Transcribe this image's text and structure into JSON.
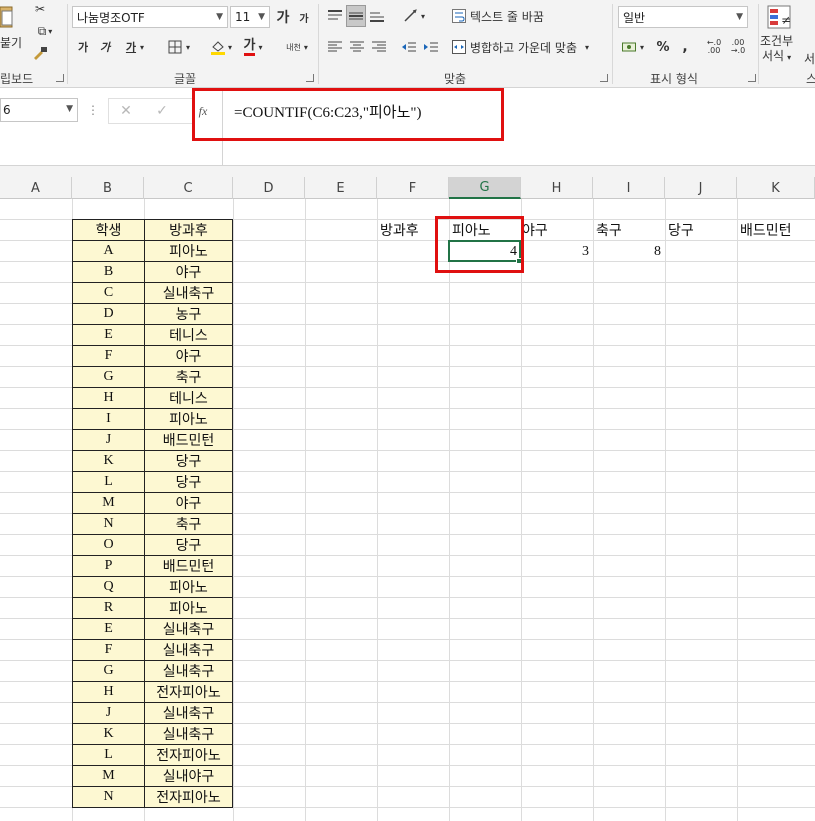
{
  "ribbon": {
    "clipboard": {
      "paste_label": "붙기",
      "group_label": "립보드"
    },
    "font": {
      "font_name": "나눔명조OTF",
      "font_size": "11",
      "grow_label": "가",
      "shrink_label": "가",
      "bold_label": "가",
      "italic_label": "가",
      "underline_label": "가",
      "font_color_label": "가",
      "phonetic_label": "내천",
      "group_label": "글꼴"
    },
    "alignment": {
      "wrap_text_label": "텍스트 줄 바꿈",
      "merge_center_label": "병합하고 가운데 맞춤",
      "group_label": "맞춤"
    },
    "number": {
      "format_value": "일반",
      "percent_label": "%",
      "comma_label": ",",
      "group_label": "표시 형식"
    },
    "styles": {
      "conditional_label_1": "조건부",
      "conditional_label_2": "서식",
      "next_label": "서",
      "group_label_partial": "스"
    }
  },
  "formula_bar": {
    "name_box": "6",
    "cancel_symbol": "✕",
    "enter_symbol": "✓",
    "fx_label": "fx",
    "formula": "=COUNTIF(C6:C23,\"피아노\")"
  },
  "columns": [
    "A",
    "B",
    "C",
    "D",
    "E",
    "F",
    "G",
    "H",
    "I",
    "J",
    "K"
  ],
  "table": {
    "header_student": "학생",
    "header_activity": "방과후",
    "rows": [
      [
        "A",
        "피아노"
      ],
      [
        "B",
        "야구"
      ],
      [
        "C",
        "실내축구"
      ],
      [
        "D",
        "농구"
      ],
      [
        "E",
        "테니스"
      ],
      [
        "F",
        "야구"
      ],
      [
        "G",
        "축구"
      ],
      [
        "H",
        "테니스"
      ],
      [
        "I",
        "피아노"
      ],
      [
        "J",
        "배드민턴"
      ],
      [
        "K",
        "당구"
      ],
      [
        "L",
        "당구"
      ],
      [
        "M",
        "야구"
      ],
      [
        "N",
        "축구"
      ],
      [
        "O",
        "당구"
      ],
      [
        "P",
        "배드민턴"
      ],
      [
        "Q",
        "피아노"
      ],
      [
        "R",
        "피아노"
      ],
      [
        "E",
        "실내축구"
      ],
      [
        "F",
        "실내축구"
      ],
      [
        "G",
        "실내축구"
      ],
      [
        "H",
        "전자피아노"
      ],
      [
        "J",
        "실내축구"
      ],
      [
        "K",
        "실내축구"
      ],
      [
        "L",
        "전자피아노"
      ],
      [
        "M",
        "실내야구"
      ],
      [
        "N",
        "전자피아노"
      ]
    ]
  },
  "summary": {
    "label": "방과후",
    "headers": [
      "피아노",
      "야구",
      "축구",
      "당구",
      "배드민턴"
    ],
    "values": [
      "4",
      "3",
      "8"
    ]
  },
  "colors": {
    "highlight_red": "#e01010",
    "excel_green": "#217346",
    "cell_fill": "#fdf8d2"
  }
}
